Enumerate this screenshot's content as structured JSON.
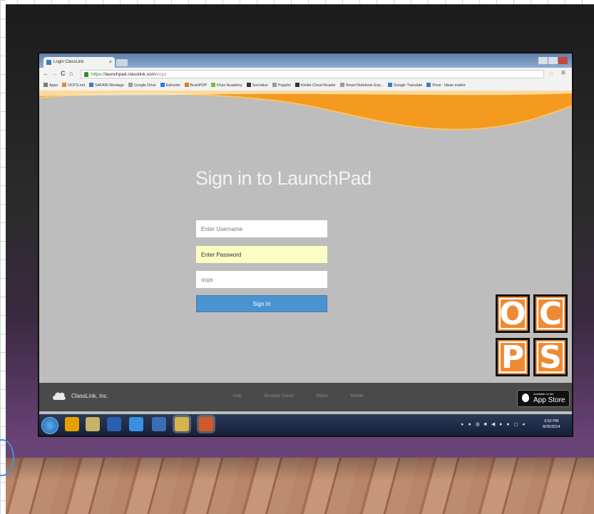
{
  "browser": {
    "tab_title": "Login ClassLink",
    "tab_close": "×",
    "url_scheme": "https://",
    "url_host": "launchpad.classlink.com",
    "url_path": "/ocps",
    "nav_back": "←",
    "nav_forward": "→",
    "nav_reload": "C",
    "nav_home": "⌂",
    "star": "☆",
    "menu": "≡",
    "bookmarks": [
      {
        "label": "Apps",
        "color": "#7a7a7a"
      },
      {
        "label": "OCPS.net",
        "color": "#e58b2a"
      },
      {
        "label": "SAFARI Montage",
        "color": "#3d7bc6"
      },
      {
        "label": "Google Drive",
        "color": "#9a9a9a"
      },
      {
        "label": "Edmodo",
        "color": "#2e7cd1"
      },
      {
        "label": "BrainPOP",
        "color": "#e07a1d"
      },
      {
        "label": "Khan Academy",
        "color": "#7dbb43"
      },
      {
        "label": "Socrative",
        "color": "#333333"
      },
      {
        "label": "Popplet",
        "color": "#9a9a9a"
      },
      {
        "label": "Kindle Cloud Reader",
        "color": "#333333"
      },
      {
        "label": "Smart Notebook Exp...",
        "color": "#9a9a9a"
      },
      {
        "label": "Google Translate",
        "color": "#3d7bc6"
      },
      {
        "label": "Prezi - Ideas matter.",
        "color": "#3d7bc6"
      }
    ]
  },
  "login": {
    "title": "Sign in to LaunchPad",
    "username_placeholder": "Enter Username",
    "password_value": "Enter Password",
    "code_placeholder": "ocps",
    "signin_label": "Sign In"
  },
  "logo": {
    "letters": [
      "O",
      "C",
      "P",
      "S"
    ],
    "color": "#ee8a33"
  },
  "footer": {
    "company": "ClassLink, Inc.",
    "links": [
      "Help",
      "Browser Check",
      "Status",
      "Mobile"
    ],
    "appstore_small": "Available on the",
    "appstore_big": "App Store"
  },
  "taskbar": {
    "apps": [
      {
        "name": "outlook",
        "color": "#e5a000"
      },
      {
        "name": "explorer",
        "color": "#c8b266"
      },
      {
        "name": "word",
        "color": "#2b5fb3"
      },
      {
        "name": "ie",
        "color": "#3a8fe0"
      },
      {
        "name": "media",
        "color": "#3b6fb5"
      },
      {
        "name": "chrome",
        "color": "#d9b34a"
      },
      {
        "name": "powerpoint",
        "color": "#d2582a"
      }
    ],
    "time": "3:52 PM",
    "date": "8/26/2014"
  },
  "colors": {
    "accent_orange": "#f39a1f",
    "signin_blue": "#4a93cf",
    "page_gray": "#bdbdbd"
  }
}
